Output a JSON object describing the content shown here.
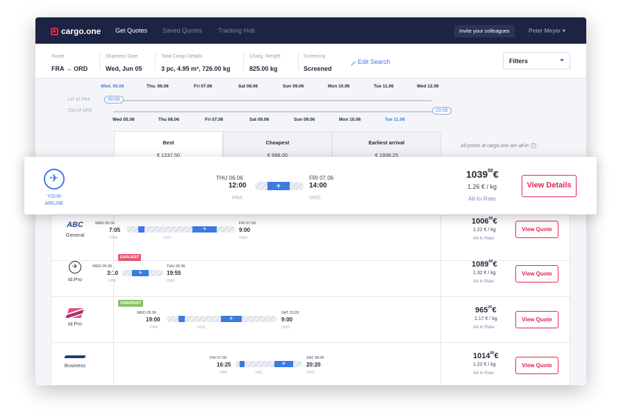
{
  "brand": "cargo.one",
  "nav": {
    "items": [
      "Get Quotes",
      "Saved Quotes",
      "Tracking Hub"
    ],
    "invite": "Invite your colleagues",
    "user": "Peter Meyer ▾"
  },
  "search": {
    "route": {
      "label": "Route",
      "value": "FRA → ORD"
    },
    "date": {
      "label": "Shipment Date",
      "value": "Wed, Jun 05"
    },
    "cargo": {
      "label": "Total Cargo Details",
      "value": "3 pc, 4.95 m³, 726.00 kg"
    },
    "weight": {
      "label": "Charg. Weight",
      "value": "825.00 kg"
    },
    "screening": {
      "label": "Screening",
      "value": "Screened"
    },
    "edit": "Edit Search",
    "filters": "Filters"
  },
  "dates": {
    "top": [
      "Wed. 05.06",
      "Thu. 06.06",
      "Fri 07.06",
      "Sat 08.06",
      "Sun 09.06",
      "Mon 10.06",
      "Tue 11.06",
      "Wed 12.06"
    ],
    "bottom": [
      "Wed 05.06",
      "Thu 06.06",
      "Fri 07.06",
      "Sat 09.06",
      "Sun 09.06",
      "Mon 10.06",
      "Tue 11.06"
    ],
    "lat_label": "LAT AT FRA",
    "toa_label": "TOA AT ORD",
    "lat_value": "00:00",
    "toa_value": "23:59"
  },
  "tabs": [
    {
      "title": "Best",
      "price": "€ 1237.50"
    },
    {
      "title": "Cheapest",
      "price": "€ 998.00"
    },
    {
      "title": "Earliest arrival",
      "price": "€ 1938.25"
    }
  ],
  "allin_note": "All prices at cargo.one are all-in",
  "featured": {
    "airline": "YOUR AIRLINE",
    "dep_date": "THU 06.06",
    "dep_time": "12:00",
    "dep_ap": "FRA",
    "arr_date": "FRI 07.06",
    "arr_time": "14:00",
    "arr_ap": "ORD",
    "price_int": "1039",
    "price_dec": "50",
    "currency": "€",
    "per_kg": "1.26 € / kg",
    "rate": "All-In Rate",
    "button": "View Details"
  },
  "quotes": [
    {
      "airline": "General",
      "logo": "ABC",
      "badge": "",
      "dep_date": "WED 05.06",
      "dep_time": "7:05",
      "dep_ap": "FRA",
      "via": "SVO",
      "arr_date": "FRI 07.06",
      "arr_time": "9:00",
      "arr_ap": "ORD",
      "price_int": "1006",
      "price_dec": "50",
      "per_kg": "1.22 € / kg",
      "rate": "All-In Rate",
      "button": "View Quote"
    },
    {
      "airline": "td.Pro",
      "logo": "",
      "badge": "EARLIEST",
      "dep_date": "WED 05.06",
      "dep_time": "3:10",
      "dep_ap": "FRA",
      "via": "",
      "arr_date": "THU 06.06",
      "arr_time": "19:55",
      "arr_ap": "ORD",
      "price_int": "1089",
      "price_dec": "00",
      "per_kg": "1.32 € / kg",
      "rate": "All-In Rate",
      "button": "View Quote"
    },
    {
      "airline": "td.Pro",
      "logo": "",
      "badge": "CHEAPEST",
      "dep_date": "WED 05.06",
      "dep_time": "19:00",
      "dep_ap": "FRA",
      "via": "DUS",
      "arr_date": "SAT 23.03",
      "arr_time": "9:00",
      "arr_ap": "ORD",
      "price_int": "965",
      "price_dec": "25",
      "per_kg": "1.17 € / kg",
      "rate": "All-In Rate",
      "button": "View Quote"
    },
    {
      "airline": "Business",
      "logo": "",
      "badge": "",
      "dep_date": "FRI 07.06",
      "dep_time": "16:25",
      "dep_ap": "FRA",
      "via": "HEL",
      "arr_date": "SAT 08.06",
      "arr_time": "20:20",
      "arr_ap": "ORD",
      "price_int": "1014",
      "price_dec": "50",
      "per_kg": "1.22 € / kg",
      "rate": "All-In Rate",
      "button": "View Quote"
    }
  ],
  "colors": {
    "navy": "#1d2342",
    "accent": "#e5234e",
    "blue": "#3c7be0",
    "earliest": "#e8566f",
    "cheapest": "#8cc16a"
  }
}
